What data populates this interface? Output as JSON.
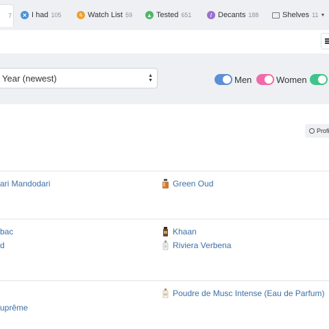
{
  "tabs": [
    {
      "label": "",
      "count": "7",
      "icon": "collection-icon",
      "active": true
    },
    {
      "label": "I had",
      "count": "105",
      "icon": "x-circle-icon",
      "color": "#4a90d9"
    },
    {
      "label": "Watch List",
      "count": "59",
      "icon": "lightning-icon",
      "color": "#f0a030"
    },
    {
      "label": "Tested",
      "count": "651",
      "icon": "flask-icon",
      "color": "#4cb86a"
    },
    {
      "label": "Decants",
      "count": "188",
      "icon": "dropper-icon",
      "color": "#9c6fd0"
    },
    {
      "label": "Shelves",
      "count": "11",
      "icon": "folder-icon",
      "color": "#888888"
    }
  ],
  "sort": {
    "value": "Year (newest)"
  },
  "toggles": [
    {
      "label": "Men",
      "color": "#5b8fd6"
    },
    {
      "label": "Women",
      "color": "#f06aa8"
    },
    {
      "label": "",
      "color": "#3fc48a"
    }
  ],
  "profile_button": "Profi",
  "items": [
    {
      "name": "ari Mandodari",
      "bottle": false
    },
    {
      "name": "Green Oud",
      "bottle": true
    },
    {
      "name": "bac",
      "bottle": false
    },
    {
      "name": "Khaan",
      "bottle": true
    },
    {
      "name": "d",
      "bottle": false
    },
    {
      "name": "Riviera Verbena",
      "bottle": true
    },
    {
      "name": "Poudre de Musc Intense (Eau de Parfum)",
      "bottle": true
    },
    {
      "name": "uprême",
      "bottle": false
    }
  ]
}
